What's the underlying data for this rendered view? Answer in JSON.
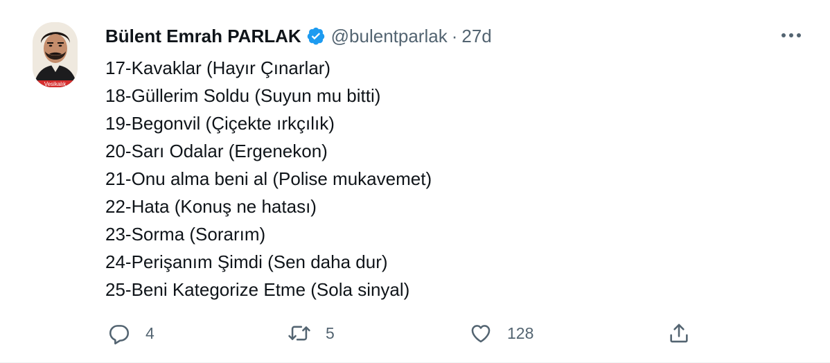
{
  "author": {
    "display_name": "Bülent Emrah PARLAK",
    "handle": "@bulentparlak",
    "separator": "·",
    "time": "27d",
    "avatar_label": "Vesikalık"
  },
  "tweet": {
    "lines": [
      "17-Kavaklar (Hayır Çınarlar)",
      "18-Güllerim Soldu (Suyun mu bitti)",
      "19-Begonvil (Çiçekte ırkçılık)",
      "20-Sarı Odalar (Ergenekon)",
      "21-Onu alma beni al (Polise mukavemet)",
      "22-Hata (Konuş ne hatası)",
      "23-Sorma (Sorarım)",
      "24-Perişanım Şimdi (Sen daha dur)",
      "25-Beni Kategorize Etme (Sola sinyal)"
    ]
  },
  "actions": {
    "reply_count": "4",
    "retweet_count": "5",
    "like_count": "128"
  },
  "colors": {
    "text": "#0f1419",
    "secondary": "#536471",
    "verified": "#1d9bf0"
  },
  "icons": {
    "more": "more-horizontal-icon",
    "verified": "verified-badge-icon",
    "reply": "reply-icon",
    "retweet": "retweet-icon",
    "like": "heart-icon",
    "share": "share-icon"
  }
}
